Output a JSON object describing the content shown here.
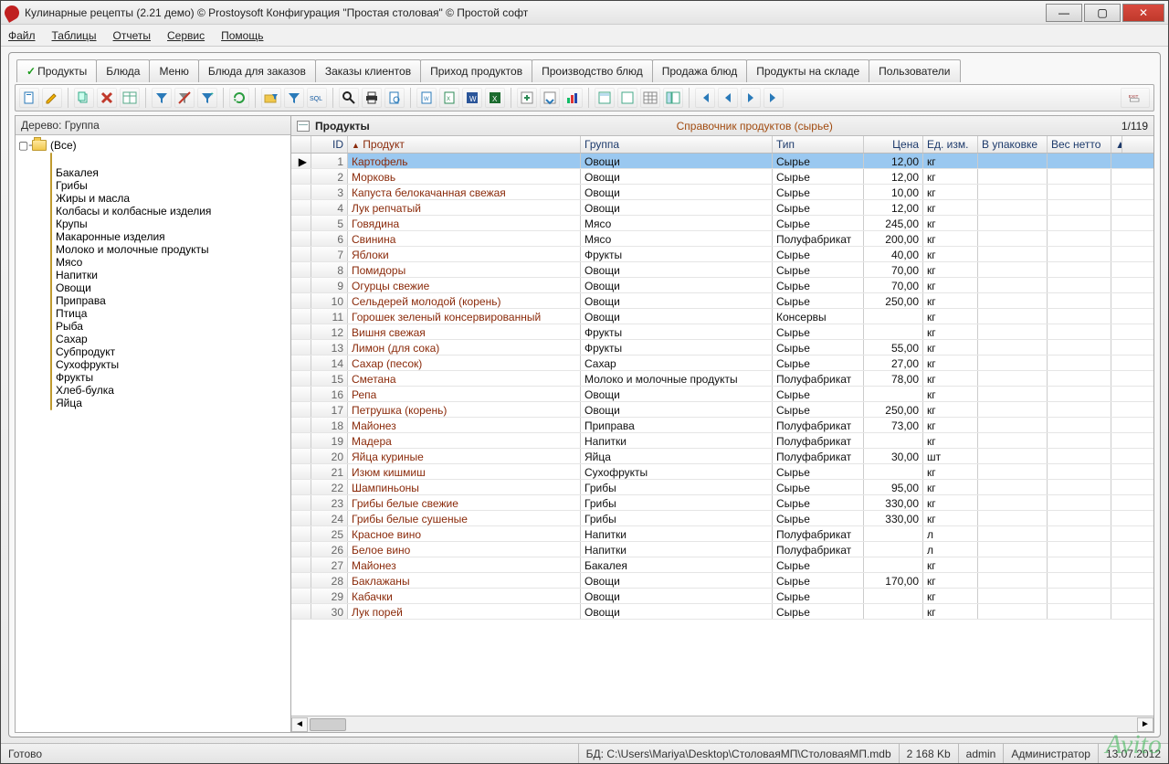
{
  "window": {
    "title": "Кулинарные рецепты (2.21 демо) © Prostoysoft   Конфигурация \"Простая столовая\" © Простой софт"
  },
  "menu": [
    "Файл",
    "Таблицы",
    "Отчеты",
    "Сервис",
    "Помощь"
  ],
  "tabs": [
    {
      "label": "Продукты",
      "active": true
    },
    {
      "label": "Блюда"
    },
    {
      "label": "Меню"
    },
    {
      "label": "Блюда для заказов"
    },
    {
      "label": "Заказы клиентов"
    },
    {
      "label": "Приход продуктов"
    },
    {
      "label": "Производство блюд"
    },
    {
      "label": "Продажа блюд"
    },
    {
      "label": "Продукты на складе"
    },
    {
      "label": "Пользователи"
    }
  ],
  "tree": {
    "header": "Дерево: Группа",
    "root": "(Все)",
    "items": [
      "",
      "Бакалея",
      "Грибы",
      "Жиры и масла",
      "Колбасы и колбасные изделия",
      "Крупы",
      "Макаронные изделия",
      "Молоко и молочные продукты",
      "Мясо",
      "Напитки",
      "Овощи",
      "Приправа",
      "Птица",
      "Рыба",
      "Сахар",
      "Субпродукт",
      "Сухофрукты",
      "Фрукты",
      "Хлеб-булка",
      "Яйца"
    ]
  },
  "grid": {
    "title": "Продукты",
    "subtitle": "Справочник продуктов (сырье)",
    "count": "1/119",
    "cols": {
      "id": "ID",
      "product": "Продукт",
      "group": "Группа",
      "type": "Тип",
      "price": "Цена",
      "unit": "Ед. изм.",
      "pack": "В упаковке",
      "net": "Вес нетто"
    },
    "sort_indicator": "▲",
    "rows": [
      {
        "id": 1,
        "product": "Картофель",
        "group": "Овощи",
        "type": "Сырье",
        "price": "12,00",
        "unit": "кг",
        "selected": true
      },
      {
        "id": 2,
        "product": "Морковь",
        "group": "Овощи",
        "type": "Сырье",
        "price": "12,00",
        "unit": "кг"
      },
      {
        "id": 3,
        "product": "Капуста белокачанная свежая",
        "group": "Овощи",
        "type": "Сырье",
        "price": "10,00",
        "unit": "кг"
      },
      {
        "id": 4,
        "product": "Лук репчатый",
        "group": "Овощи",
        "type": "Сырье",
        "price": "12,00",
        "unit": "кг"
      },
      {
        "id": 5,
        "product": "Говядина",
        "group": "Мясо",
        "type": "Сырье",
        "price": "245,00",
        "unit": "кг"
      },
      {
        "id": 6,
        "product": "Свинина",
        "group": "Мясо",
        "type": "Полуфабрикат",
        "price": "200,00",
        "unit": "кг"
      },
      {
        "id": 7,
        "product": "Яблоки",
        "group": "Фрукты",
        "type": "Сырье",
        "price": "40,00",
        "unit": "кг"
      },
      {
        "id": 8,
        "product": "Помидоры",
        "group": "Овощи",
        "type": "Сырье",
        "price": "70,00",
        "unit": "кг"
      },
      {
        "id": 9,
        "product": "Огурцы свежие",
        "group": "Овощи",
        "type": "Сырье",
        "price": "70,00",
        "unit": "кг"
      },
      {
        "id": 10,
        "product": "Сельдерей молодой (корень)",
        "group": "Овощи",
        "type": "Сырье",
        "price": "250,00",
        "unit": "кг"
      },
      {
        "id": 11,
        "product": "Горошек зеленый консервированный",
        "group": "Овощи",
        "type": "Консервы",
        "price": "",
        "unit": "кг"
      },
      {
        "id": 12,
        "product": "Вишня свежая",
        "group": "Фрукты",
        "type": "Сырье",
        "price": "",
        "unit": "кг"
      },
      {
        "id": 13,
        "product": "Лимон (для сока)",
        "group": "Фрукты",
        "type": "Сырье",
        "price": "55,00",
        "unit": "кг"
      },
      {
        "id": 14,
        "product": "Сахар (песок)",
        "group": "Сахар",
        "type": "Сырье",
        "price": "27,00",
        "unit": "кг"
      },
      {
        "id": 15,
        "product": "Сметана",
        "group": "Молоко и молочные продукты",
        "type": "Полуфабрикат",
        "price": "78,00",
        "unit": "кг"
      },
      {
        "id": 16,
        "product": "Репа",
        "group": "Овощи",
        "type": "Сырье",
        "price": "",
        "unit": "кг"
      },
      {
        "id": 17,
        "product": "Петрушка (корень)",
        "group": "Овощи",
        "type": "Сырье",
        "price": "250,00",
        "unit": "кг"
      },
      {
        "id": 18,
        "product": "Майонез",
        "group": "Приправа",
        "type": "Полуфабрикат",
        "price": "73,00",
        "unit": "кг"
      },
      {
        "id": 19,
        "product": "Мадера",
        "group": "Напитки",
        "type": "Полуфабрикат",
        "price": "",
        "unit": "кг"
      },
      {
        "id": 20,
        "product": "Яйца куриные",
        "group": "Яйца",
        "type": "Полуфабрикат",
        "price": "30,00",
        "unit": "шт"
      },
      {
        "id": 21,
        "product": "Изюм кишмиш",
        "group": "Сухофрукты",
        "type": "Сырье",
        "price": "",
        "unit": "кг"
      },
      {
        "id": 22,
        "product": "Шампиньоны",
        "group": "Грибы",
        "type": "Сырье",
        "price": "95,00",
        "unit": "кг"
      },
      {
        "id": 23,
        "product": "Грибы белые свежие",
        "group": "Грибы",
        "type": "Сырье",
        "price": "330,00",
        "unit": "кг"
      },
      {
        "id": 24,
        "product": "Грибы белые сушеные",
        "group": "Грибы",
        "type": "Сырье",
        "price": "330,00",
        "unit": "кг"
      },
      {
        "id": 25,
        "product": "Красное вино",
        "group": "Напитки",
        "type": "Полуфабрикат",
        "price": "",
        "unit": "л"
      },
      {
        "id": 26,
        "product": "Белое вино",
        "group": "Напитки",
        "type": "Полуфабрикат",
        "price": "",
        "unit": "л"
      },
      {
        "id": 27,
        "product": "Майонез",
        "group": "Бакалея",
        "type": "Сырье",
        "price": "",
        "unit": "кг"
      },
      {
        "id": 28,
        "product": "Баклажаны",
        "group": "Овощи",
        "type": "Сырье",
        "price": "170,00",
        "unit": "кг"
      },
      {
        "id": 29,
        "product": "Кабачки",
        "group": "Овощи",
        "type": "Сырье",
        "price": "",
        "unit": "кг"
      },
      {
        "id": 30,
        "product": "Лук порей",
        "group": "Овощи",
        "type": "Сырье",
        "price": "",
        "unit": "кг"
      }
    ]
  },
  "status": {
    "ready": "Готово",
    "db_label": "БД:",
    "db_path": "C:\\Users\\Mariya\\Desktop\\СтоловаяМП\\СтоловаяМП.mdb",
    "size": "2 168 Kb",
    "user": "admin",
    "role": "Администратор",
    "date": "13.07.2012"
  },
  "watermark": "Avito"
}
